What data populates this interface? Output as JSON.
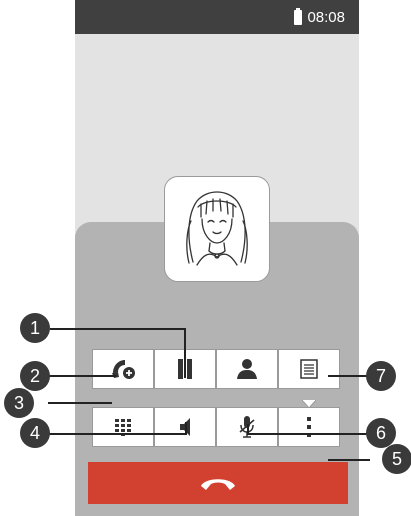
{
  "status_bar": {
    "time": "08:08"
  },
  "callouts": [
    "1",
    "2",
    "3",
    "4",
    "5",
    "6",
    "7"
  ],
  "colors": {
    "end_call": "#d2402f",
    "status_bar": "#404040"
  },
  "buttons": {
    "row1": [
      "add-call-icon",
      "pause-icon",
      "contact-icon",
      "notes-icon"
    ],
    "row2": [
      "dialpad-icon",
      "speaker-icon",
      "mute-icon",
      "more-icon"
    ]
  }
}
